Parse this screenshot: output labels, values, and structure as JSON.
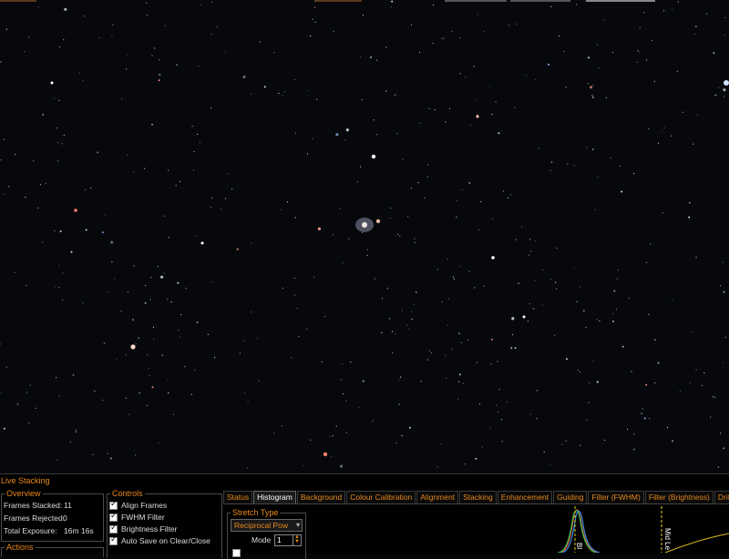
{
  "window": {
    "title": "Live Stacking"
  },
  "overview": {
    "title": "Overview",
    "frames_stacked_label": "Frames Stacked:",
    "frames_stacked_value": "11",
    "frames_rejected_label": "Frames Rejected:",
    "frames_rejected_value": "0",
    "total_exposure_label": "Total Exposure:",
    "total_exposure_value": "16m 16s"
  },
  "actions": {
    "title": "Actions"
  },
  "controls": {
    "title": "Controls",
    "items": [
      {
        "label": "Align Frames",
        "checked": true
      },
      {
        "label": "FWHM Filter",
        "checked": true
      },
      {
        "label": "Brightness Filter",
        "checked": true
      },
      {
        "label": "Auto Save on Clear/Close",
        "checked": true
      }
    ]
  },
  "tabs": [
    {
      "label": "Status",
      "active": false
    },
    {
      "label": "Histogram",
      "active": true
    },
    {
      "label": "Background",
      "active": false
    },
    {
      "label": "Colour Calibration",
      "active": false
    },
    {
      "label": "Alignment",
      "active": false
    },
    {
      "label": "Stacking",
      "active": false
    },
    {
      "label": "Enhancement",
      "active": false
    },
    {
      "label": "Guiding",
      "active": false
    },
    {
      "label": "Filter (FWHM)",
      "active": false
    },
    {
      "label": "Filter (Brightness)",
      "active": false
    },
    {
      "label": "Drift Gr",
      "active": false
    }
  ],
  "histogram": {
    "stretch_type_title": "Stretch Type",
    "stretch_type_value": "Reciprocal Pow",
    "mode_label": "Mode",
    "mode_value": "1",
    "black_label": "Bl",
    "mid_label": "Mid Le"
  },
  "colors": {
    "accent": "#e8891a",
    "panel_bg": "#000000",
    "sky_bg": "#06080b"
  }
}
